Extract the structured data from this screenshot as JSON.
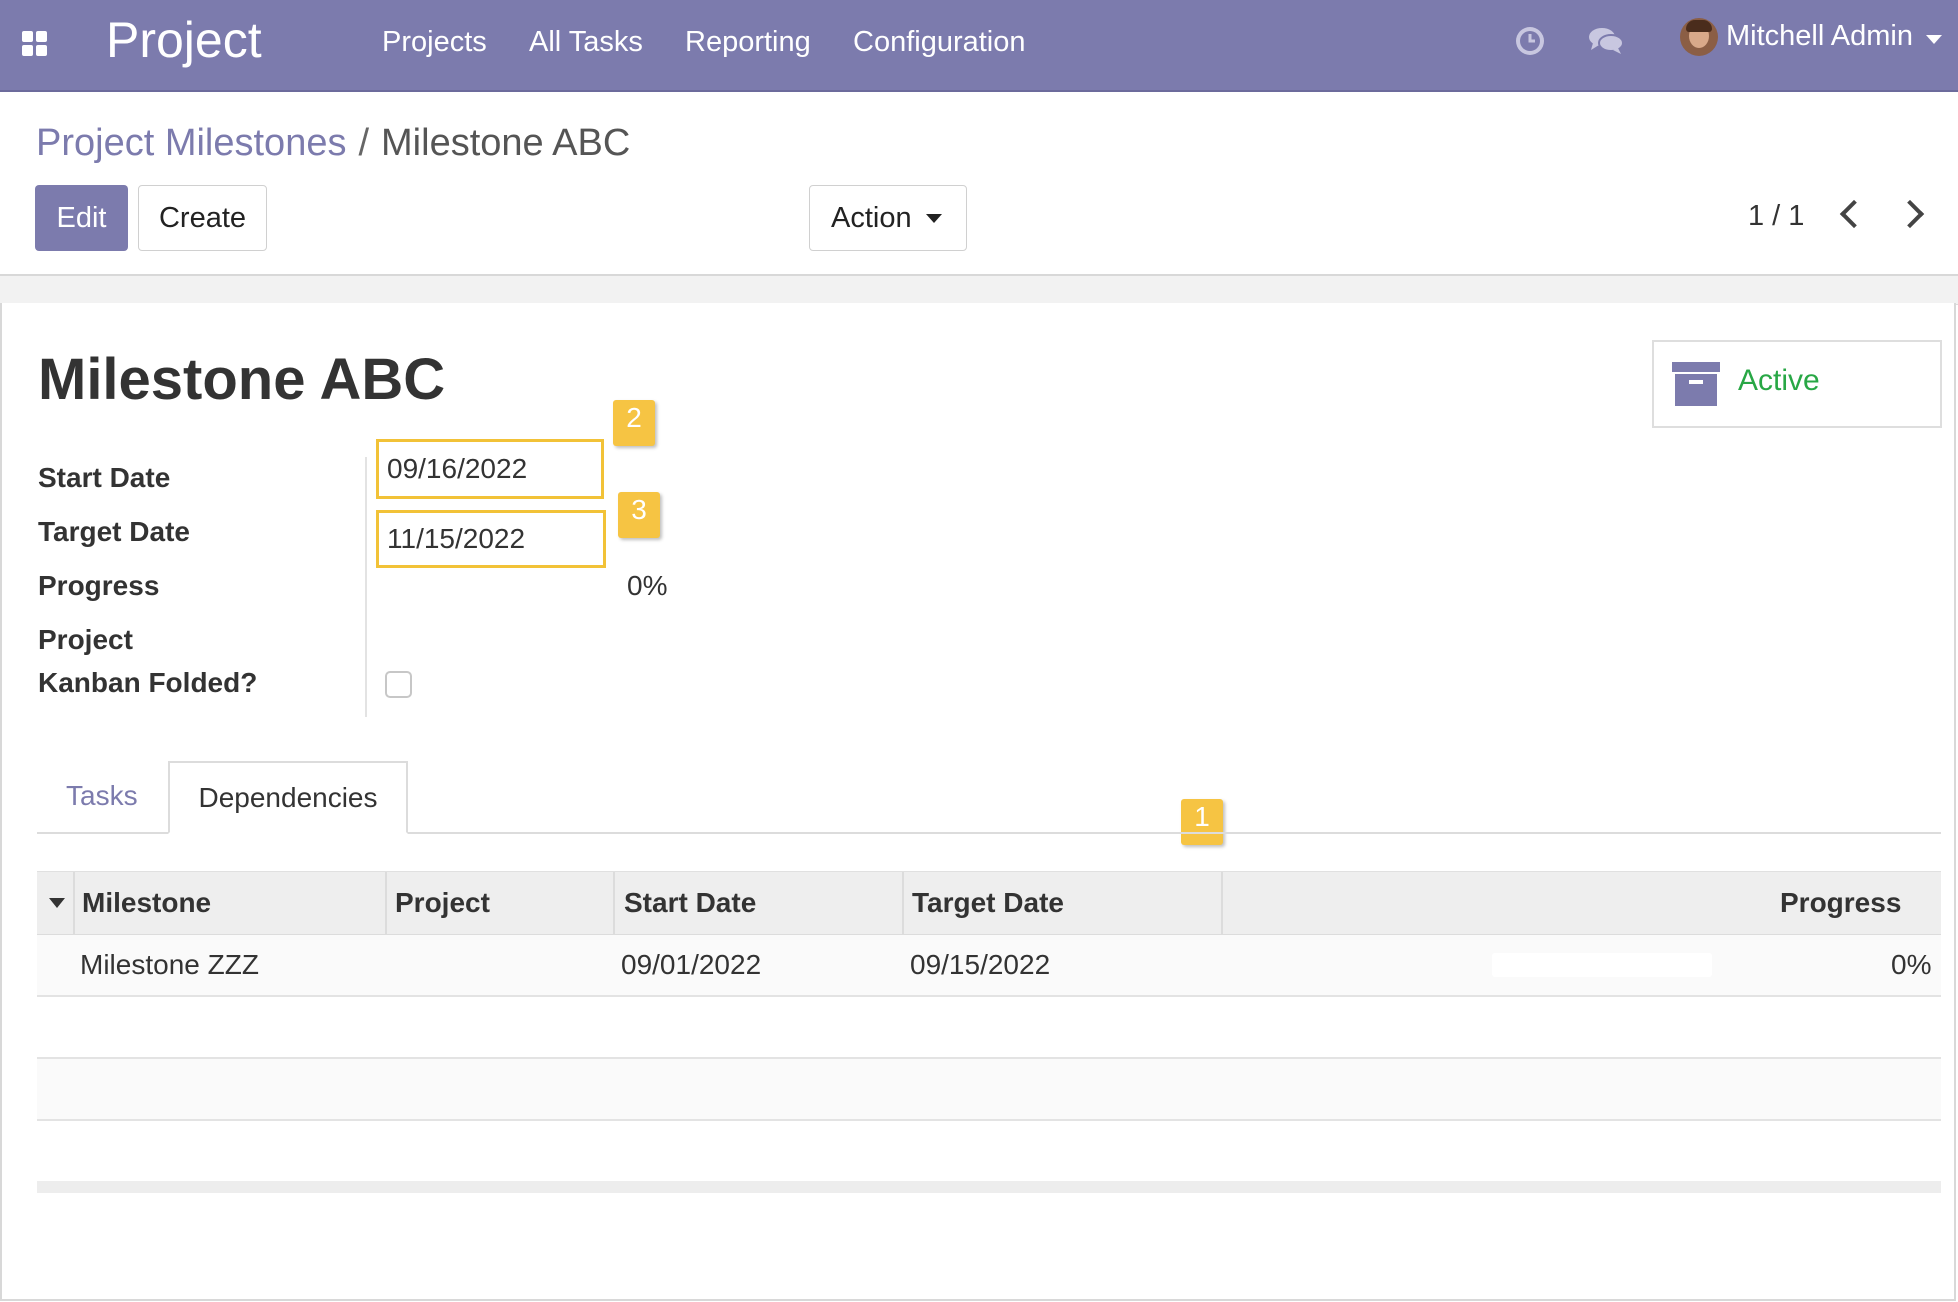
{
  "navbar": {
    "app_name": "Project",
    "menu": [
      "Projects",
      "All Tasks",
      "Reporting",
      "Configuration"
    ],
    "user_name": "Mitchell Admin",
    "color": "#7c7bad"
  },
  "breadcrumb": {
    "parent": "Project Milestones",
    "separator": "/",
    "current": "Milestone ABC"
  },
  "toolbar": {
    "edit_label": "Edit",
    "create_label": "Create",
    "action_label": "Action",
    "pager": "1 / 1"
  },
  "record": {
    "title": "Milestone ABC",
    "status_label": "Active",
    "fields": {
      "start_date_label": "Start Date",
      "start_date": "09/16/2022",
      "target_date_label": "Target Date",
      "target_date": "11/15/2022",
      "progress_label": "Progress",
      "progress": "0%",
      "kanban_label_line1": "Project",
      "kanban_label_line2": "Kanban Folded?",
      "kanban_folded": false
    }
  },
  "tabs": [
    {
      "label": "Tasks",
      "active": false
    },
    {
      "label": "Dependencies",
      "active": true
    }
  ],
  "dependencies_table": {
    "columns": [
      "Milestone",
      "Project",
      "Start Date",
      "Target Date",
      "Progress"
    ],
    "rows": [
      {
        "milestone": "Milestone ZZZ",
        "project": "",
        "start_date": "09/01/2022",
        "target_date": "09/15/2022",
        "progress": "0%"
      }
    ]
  },
  "annotations": {
    "badges": [
      "1",
      "2",
      "3"
    ],
    "color": "#f2c237"
  },
  "colors": {
    "accent": "#7c7bad",
    "active_green": "#28a745",
    "highlight": "#f6c443"
  }
}
